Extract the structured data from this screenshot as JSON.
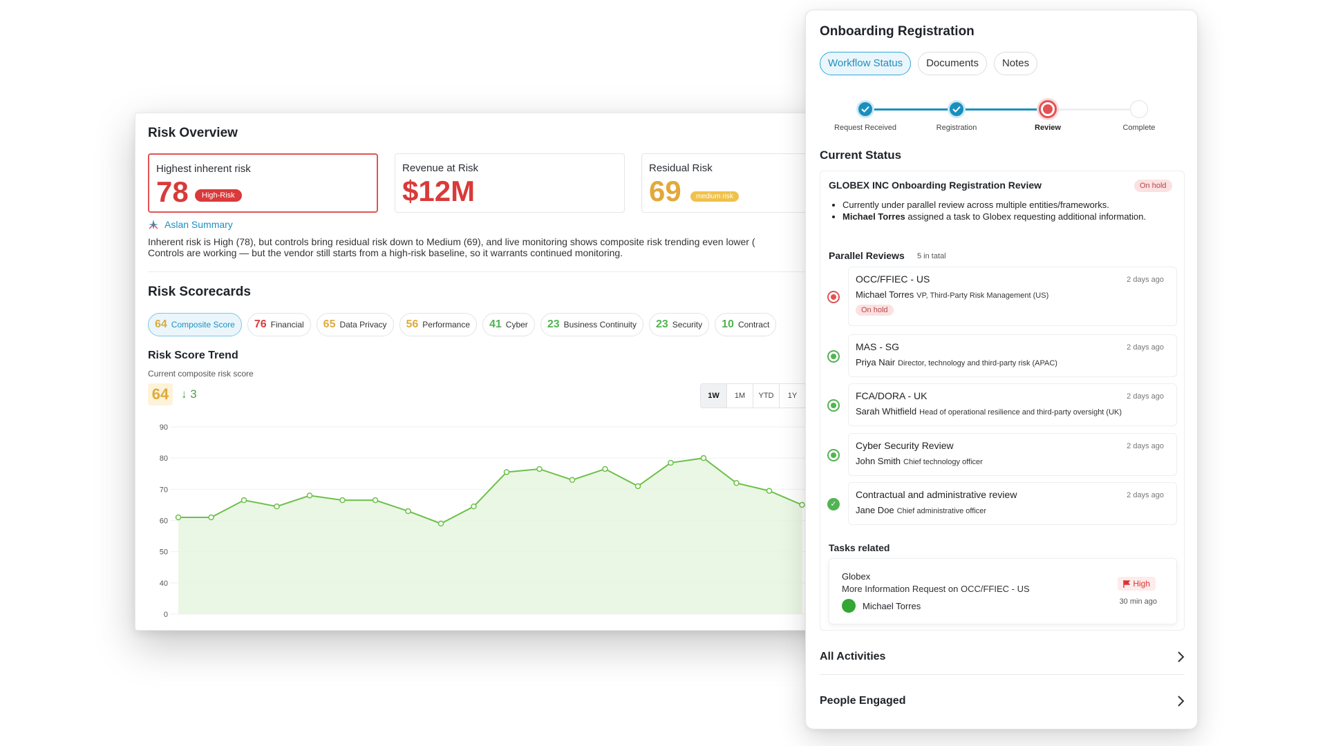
{
  "risk_overview": {
    "title": "Risk Overview",
    "metrics": [
      {
        "label": "Highest inherent risk",
        "value": "78",
        "badge": "High-Risk",
        "value_color": "#d93a3a",
        "badge_color": "#d93a3a"
      },
      {
        "label": "Revenue at Risk",
        "value": "$12M",
        "value_color": "#d93a3a"
      },
      {
        "label": "Residual Risk",
        "value": "69",
        "badge": "medium risk",
        "value_color": "#e3a83a",
        "badge_color": "#f0c14b"
      }
    ],
    "summary_title": "Aslan Summary",
    "summary_text": "Inherent risk is High (78), but controls bring residual risk down to Medium (69), and live monitoring shows composite risk trending even lower (\nControls are working — but the vendor still starts from a high-risk baseline, so it warrants continued monitoring."
  },
  "scorecards": {
    "title": "Risk Scorecards",
    "pills": [
      {
        "num": "64",
        "label": "Composite Score",
        "color": "#e0a93b"
      },
      {
        "num": "76",
        "label": "Financial",
        "color": "#d93a3a"
      },
      {
        "num": "65",
        "label": "Data Privacy",
        "color": "#e0a93b"
      },
      {
        "num": "56",
        "label": "Performance",
        "color": "#e0a93b"
      },
      {
        "num": "41",
        "label": "Cyber",
        "color": "#52b352"
      },
      {
        "num": "23",
        "label": "Business Continuity",
        "color": "#52b352"
      },
      {
        "num": "23",
        "label": "Security",
        "color": "#52b352"
      },
      {
        "num": "10",
        "label": "Contract",
        "color": "#52b352"
      }
    ]
  },
  "trend": {
    "title": "Risk Score Trend",
    "subtitle": "Current composite risk score",
    "score": "64",
    "delta": "↓ 3",
    "ranges": [
      "1W",
      "1M",
      "YTD",
      "1Y"
    ],
    "active_range": "1W"
  },
  "chart_data": {
    "type": "area",
    "ylim": [
      0,
      90
    ],
    "yticks": [
      0,
      40,
      50,
      60,
      70,
      80,
      90
    ],
    "values": [
      61,
      61,
      66.5,
      64.5,
      68,
      66.5,
      66.5,
      63,
      59,
      64.5,
      75.5,
      76.5,
      73,
      76.5,
      71,
      78.5,
      80,
      72,
      69.5,
      65
    ],
    "line_color": "#6cc04a",
    "fill_color": "#e6f5df",
    "grid": true
  },
  "onboarding": {
    "title": "Onboarding Registration",
    "tabs": [
      "Workflow Status",
      "Documents",
      "Notes"
    ],
    "active_tab": 0,
    "steps": [
      {
        "label": "Request Received",
        "state": "done"
      },
      {
        "label": "Registration",
        "state": "done"
      },
      {
        "label": "Review",
        "state": "current"
      },
      {
        "label": "Complete",
        "state": "pending"
      }
    ],
    "current_status_title": "Current Status",
    "status_card": {
      "heading": "GLOBEX INC Onboarding Registration Review",
      "badge": "On hold",
      "bullet1": "Currently under parallel review across multiple entities/frameworks.",
      "bullet2_name": "Michael Torres",
      "bullet2_text": " assigned a task to Globex requesting additional information."
    },
    "parallel_reviews_title": "Parallel Reviews",
    "parallel_reviews_count": "5 in tatal",
    "reviews": [
      {
        "name": "OCC/FFIEC - US",
        "person": "Michael Torres",
        "role": "VP, Third-Party Risk Management (US)",
        "time": "2 days ago",
        "status": "red",
        "badge": "On hold"
      },
      {
        "name": "MAS - SG",
        "person": "Priya Nair",
        "role": "Director, technology and third-party risk (APAC)",
        "time": "2 days ago",
        "status": "green"
      },
      {
        "name": "FCA/DORA - UK",
        "person": "Sarah Whitfield",
        "role": "Head of operational resilience and third-party oversight (UK)",
        "time": "2 days ago",
        "status": "green"
      },
      {
        "name": "Cyber Security Review",
        "person": "John Smith",
        "role": "Chief technology officer",
        "time": "2 days ago",
        "status": "green"
      },
      {
        "name": "Contractual and administrative review",
        "person": "Jane Doe",
        "role": "Chief administrative officer",
        "time": "2 days ago",
        "status": "check"
      }
    ],
    "tasks_title": "Tasks related",
    "task": {
      "org": "Globex",
      "description": "More Information Request on OCC/FFIEC - US",
      "assignee": "Michael Torres",
      "priority": "High",
      "time": "30 min ago"
    },
    "sections": [
      "All Activities",
      "People Engaged"
    ]
  }
}
